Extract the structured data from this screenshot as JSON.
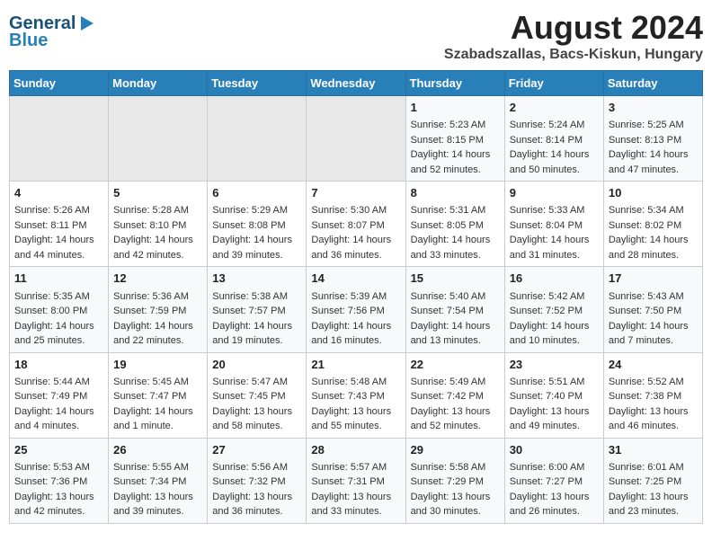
{
  "header": {
    "logo_line1": "General",
    "logo_line2": "Blue",
    "month_year": "August 2024",
    "location": "Szabadszallas, Bacs-Kiskun, Hungary"
  },
  "days_of_week": [
    "Sunday",
    "Monday",
    "Tuesday",
    "Wednesday",
    "Thursday",
    "Friday",
    "Saturday"
  ],
  "weeks": [
    [
      {
        "day": "",
        "info": ""
      },
      {
        "day": "",
        "info": ""
      },
      {
        "day": "",
        "info": ""
      },
      {
        "day": "",
        "info": ""
      },
      {
        "day": "1",
        "info": "Sunrise: 5:23 AM\nSunset: 8:15 PM\nDaylight: 14 hours\nand 52 minutes."
      },
      {
        "day": "2",
        "info": "Sunrise: 5:24 AM\nSunset: 8:14 PM\nDaylight: 14 hours\nand 50 minutes."
      },
      {
        "day": "3",
        "info": "Sunrise: 5:25 AM\nSunset: 8:13 PM\nDaylight: 14 hours\nand 47 minutes."
      }
    ],
    [
      {
        "day": "4",
        "info": "Sunrise: 5:26 AM\nSunset: 8:11 PM\nDaylight: 14 hours\nand 44 minutes."
      },
      {
        "day": "5",
        "info": "Sunrise: 5:28 AM\nSunset: 8:10 PM\nDaylight: 14 hours\nand 42 minutes."
      },
      {
        "day": "6",
        "info": "Sunrise: 5:29 AM\nSunset: 8:08 PM\nDaylight: 14 hours\nand 39 minutes."
      },
      {
        "day": "7",
        "info": "Sunrise: 5:30 AM\nSunset: 8:07 PM\nDaylight: 14 hours\nand 36 minutes."
      },
      {
        "day": "8",
        "info": "Sunrise: 5:31 AM\nSunset: 8:05 PM\nDaylight: 14 hours\nand 33 minutes."
      },
      {
        "day": "9",
        "info": "Sunrise: 5:33 AM\nSunset: 8:04 PM\nDaylight: 14 hours\nand 31 minutes."
      },
      {
        "day": "10",
        "info": "Sunrise: 5:34 AM\nSunset: 8:02 PM\nDaylight: 14 hours\nand 28 minutes."
      }
    ],
    [
      {
        "day": "11",
        "info": "Sunrise: 5:35 AM\nSunset: 8:00 PM\nDaylight: 14 hours\nand 25 minutes."
      },
      {
        "day": "12",
        "info": "Sunrise: 5:36 AM\nSunset: 7:59 PM\nDaylight: 14 hours\nand 22 minutes."
      },
      {
        "day": "13",
        "info": "Sunrise: 5:38 AM\nSunset: 7:57 PM\nDaylight: 14 hours\nand 19 minutes."
      },
      {
        "day": "14",
        "info": "Sunrise: 5:39 AM\nSunset: 7:56 PM\nDaylight: 14 hours\nand 16 minutes."
      },
      {
        "day": "15",
        "info": "Sunrise: 5:40 AM\nSunset: 7:54 PM\nDaylight: 14 hours\nand 13 minutes."
      },
      {
        "day": "16",
        "info": "Sunrise: 5:42 AM\nSunset: 7:52 PM\nDaylight: 14 hours\nand 10 minutes."
      },
      {
        "day": "17",
        "info": "Sunrise: 5:43 AM\nSunset: 7:50 PM\nDaylight: 14 hours\nand 7 minutes."
      }
    ],
    [
      {
        "day": "18",
        "info": "Sunrise: 5:44 AM\nSunset: 7:49 PM\nDaylight: 14 hours\nand 4 minutes."
      },
      {
        "day": "19",
        "info": "Sunrise: 5:45 AM\nSunset: 7:47 PM\nDaylight: 14 hours\nand 1 minute."
      },
      {
        "day": "20",
        "info": "Sunrise: 5:47 AM\nSunset: 7:45 PM\nDaylight: 13 hours\nand 58 minutes."
      },
      {
        "day": "21",
        "info": "Sunrise: 5:48 AM\nSunset: 7:43 PM\nDaylight: 13 hours\nand 55 minutes."
      },
      {
        "day": "22",
        "info": "Sunrise: 5:49 AM\nSunset: 7:42 PM\nDaylight: 13 hours\nand 52 minutes."
      },
      {
        "day": "23",
        "info": "Sunrise: 5:51 AM\nSunset: 7:40 PM\nDaylight: 13 hours\nand 49 minutes."
      },
      {
        "day": "24",
        "info": "Sunrise: 5:52 AM\nSunset: 7:38 PM\nDaylight: 13 hours\nand 46 minutes."
      }
    ],
    [
      {
        "day": "25",
        "info": "Sunrise: 5:53 AM\nSunset: 7:36 PM\nDaylight: 13 hours\nand 42 minutes."
      },
      {
        "day": "26",
        "info": "Sunrise: 5:55 AM\nSunset: 7:34 PM\nDaylight: 13 hours\nand 39 minutes."
      },
      {
        "day": "27",
        "info": "Sunrise: 5:56 AM\nSunset: 7:32 PM\nDaylight: 13 hours\nand 36 minutes."
      },
      {
        "day": "28",
        "info": "Sunrise: 5:57 AM\nSunset: 7:31 PM\nDaylight: 13 hours\nand 33 minutes."
      },
      {
        "day": "29",
        "info": "Sunrise: 5:58 AM\nSunset: 7:29 PM\nDaylight: 13 hours\nand 30 minutes."
      },
      {
        "day": "30",
        "info": "Sunrise: 6:00 AM\nSunset: 7:27 PM\nDaylight: 13 hours\nand 26 minutes."
      },
      {
        "day": "31",
        "info": "Sunrise: 6:01 AM\nSunset: 7:25 PM\nDaylight: 13 hours\nand 23 minutes."
      }
    ]
  ]
}
